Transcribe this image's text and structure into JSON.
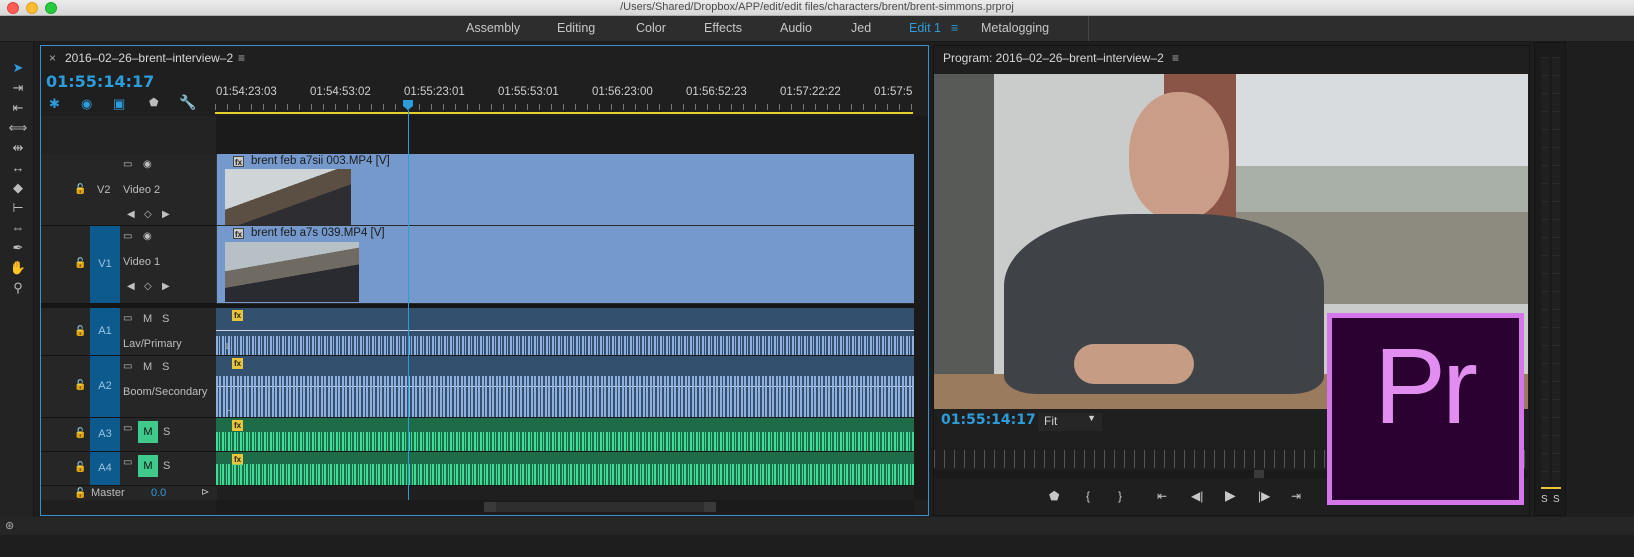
{
  "window": {
    "title": "/Users/Shared/Dropbox/APP/edit/edit files/characters/brent/brent-simmons.prproj"
  },
  "workspaces": [
    "Assembly",
    "Editing",
    "Color",
    "Effects",
    "Audio",
    "Jed",
    "Edit 1",
    "Metalogging"
  ],
  "active_workspace": "Edit 1",
  "timeline": {
    "close": "×",
    "sequence_name": "2016–02–26–brent–interview–2",
    "menu": "≡",
    "timecode": "01:55:14:17",
    "ruler": [
      "01:54:23:03",
      "01:54:53:02",
      "01:55:23:01",
      "01:55:53:01",
      "01:56:23:00",
      "01:56:52:23",
      "01:57:22:22",
      "01:57:5"
    ],
    "tracks": {
      "v2": {
        "id": "V2",
        "name": "Video 2",
        "clip": "brent feb a7sii 003.MP4 [V]"
      },
      "v1": {
        "id": "V1",
        "name": "Video 1",
        "clip": "brent feb a7s 039.MP4 [V]"
      },
      "a1": {
        "id": "A1",
        "name": "Lav/Primary"
      },
      "a2": {
        "id": "A2",
        "name": "Boom/Secondary"
      },
      "a3": {
        "id": "A3"
      },
      "a4": {
        "id": "A4"
      },
      "master": {
        "name": "Master",
        "value": "0.0"
      }
    },
    "mute": "M",
    "solo": "S",
    "fx": "fx",
    "clip_l": "L"
  },
  "program": {
    "title": "Program: 2016–02–26–brent–interview–2",
    "menu": "≡",
    "timecode": "01:55:14:17",
    "zoom": "Fit",
    "logo_text": "Pr"
  },
  "meter": {
    "labels": [
      "S",
      "S"
    ]
  },
  "colors": {
    "accent": "#2d9cdb",
    "video_clip": "#7599cc",
    "audio_clip_blue": "#34506f",
    "audio_clip_green": "#1e7a4f",
    "pr_logo": "#d475ea"
  }
}
